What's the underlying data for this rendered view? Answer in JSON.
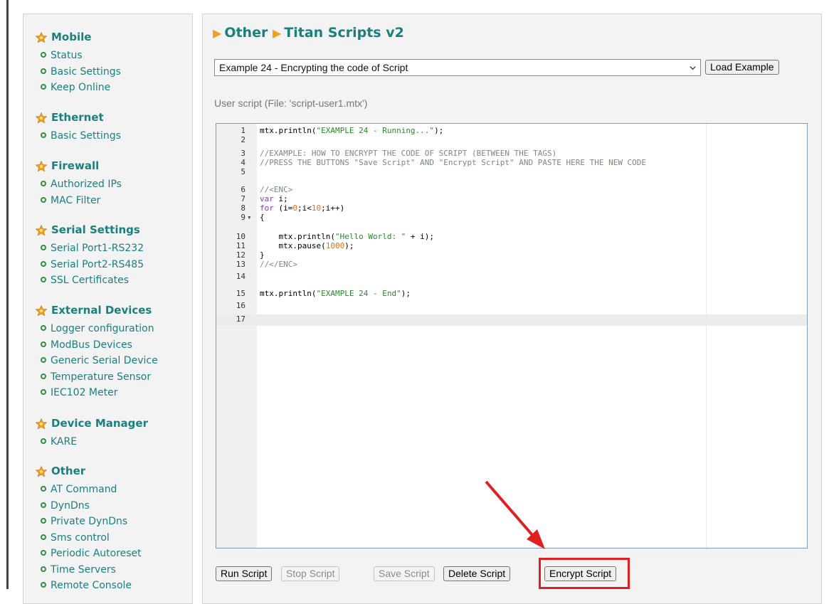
{
  "sidebar": {
    "sections": [
      {
        "title": "Mobile",
        "items": [
          "Status",
          "Basic Settings",
          "Keep Online"
        ]
      },
      {
        "title": "Ethernet",
        "items": [
          "Basic Settings"
        ]
      },
      {
        "title": "Firewall",
        "items": [
          "Authorized IPs",
          "MAC Filter"
        ]
      },
      {
        "title": "Serial Settings",
        "items": [
          "Serial Port1-RS232",
          "Serial Port2-RS485",
          "SSL Certificates"
        ]
      },
      {
        "title": "External Devices",
        "items": [
          "Logger configuration",
          "ModBus Devices",
          "Generic Serial Device",
          "Temperature Sensor",
          "IEC102 Meter"
        ]
      },
      {
        "title": "Device Manager",
        "items": [
          "KARE"
        ]
      },
      {
        "title": "Other",
        "items": [
          "AT Command",
          "DynDns",
          "Private DynDns",
          "Sms control",
          "Periodic Autoreset",
          "Time Servers",
          "Remote Console"
        ]
      }
    ]
  },
  "header": {
    "breadcrumb": [
      "Other",
      "Titan Scripts v2"
    ]
  },
  "example_select": {
    "selected": "Example 24 - Encrypting the code of Script"
  },
  "buttons": {
    "load_example": "Load Example",
    "run": "Run Script",
    "stop": "Stop Script",
    "save": "Save Script",
    "delete": "Delete Script",
    "encrypt": "Encrypt Script"
  },
  "script_label": "User script (File: 'script-user1.mtx')",
  "editor": {
    "active_line": 17,
    "lines": [
      {
        "n": "1",
        "code": "mtx.println(\"EXAMPLE 24 - Running...\");"
      },
      {
        "n": "2",
        "code": ""
      },
      {
        "n": "3",
        "code": "//EXAMPLE: HOW TO ENCRYPT THE CODE OF SCRIPT (BETWEEN THE TAGS)"
      },
      {
        "n": "4",
        "code": "//PRESS THE BUTTONS \"Save Script\" AND \"Encrypt Script\" AND PASTE HERE THE NEW CODE"
      },
      {
        "n": "5",
        "code": ""
      },
      {
        "n": "6",
        "code": "//<ENC>"
      },
      {
        "n": "7",
        "code": "var i;"
      },
      {
        "n": "8",
        "code": "for (i=0;i<10;i++)"
      },
      {
        "n": "9",
        "code": "{"
      },
      {
        "n": "10",
        "code": "    mtx.println(\"Hello World: \" + i);"
      },
      {
        "n": "11",
        "code": "    mtx.pause(1000);"
      },
      {
        "n": "12",
        "code": "}"
      },
      {
        "n": "13",
        "code": "//</ENC>"
      },
      {
        "n": "14",
        "code": ""
      },
      {
        "n": "15",
        "code": "mtx.println(\"EXAMPLE 24 - End\");"
      },
      {
        "n": "16",
        "code": ""
      },
      {
        "n": "17",
        "code": ""
      }
    ]
  },
  "colors": {
    "link": "#1a7f7f",
    "annotation": "#e02020",
    "bullet": "#2f8f3f",
    "star": "#f0a020"
  }
}
